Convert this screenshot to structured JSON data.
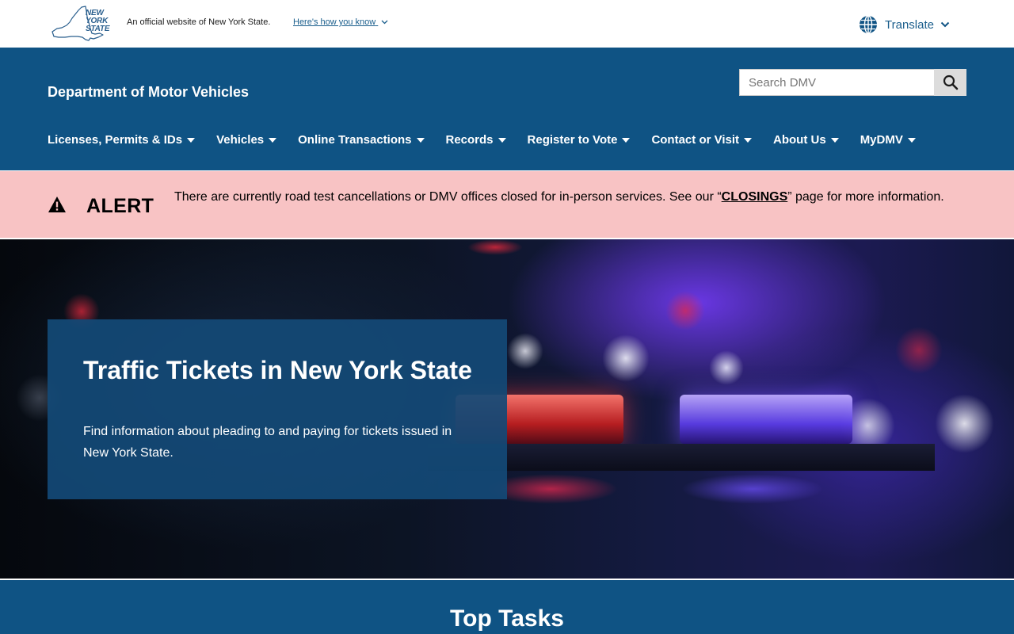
{
  "gov_bar": {
    "logo_text": [
      "NEW",
      "YORK",
      "STATE"
    ],
    "official_text": "An official website of New York State.",
    "how_know_label": "Here's how you know",
    "translate_label": "Translate"
  },
  "header": {
    "agency_name": "Department of Motor Vehicles",
    "search": {
      "placeholder": "Search DMV",
      "value": ""
    },
    "nav": [
      {
        "label": "Licenses, Permits & IDs"
      },
      {
        "label": "Vehicles"
      },
      {
        "label": "Online Transactions"
      },
      {
        "label": "Records"
      },
      {
        "label": "Register to Vote"
      },
      {
        "label": "Contact or Visit"
      },
      {
        "label": "About Us"
      },
      {
        "label": "MyDMV"
      }
    ]
  },
  "alert": {
    "title": "ALERT",
    "message_before": "There are currently road test cancellations or DMV offices closed for in-person services. See our “",
    "link_label": "CLOSINGS",
    "message_after": "” page for more information."
  },
  "hero": {
    "title": "Traffic Tickets in New York State",
    "subtitle": "Find information about pleading to and paying for tickets issued in New York State."
  },
  "top_tasks": {
    "title": "Top Tasks"
  },
  "colors": {
    "brand_blue": "#0f5384",
    "hero_card": "#134976",
    "alert_bg": "#f8c3c4",
    "link_blue": "#1a5e8c"
  },
  "icons": [
    "ny-state-outline-icon",
    "chevron-down-icon",
    "globe-icon",
    "search-icon",
    "caret-down-icon",
    "warning-triangle-icon"
  ]
}
